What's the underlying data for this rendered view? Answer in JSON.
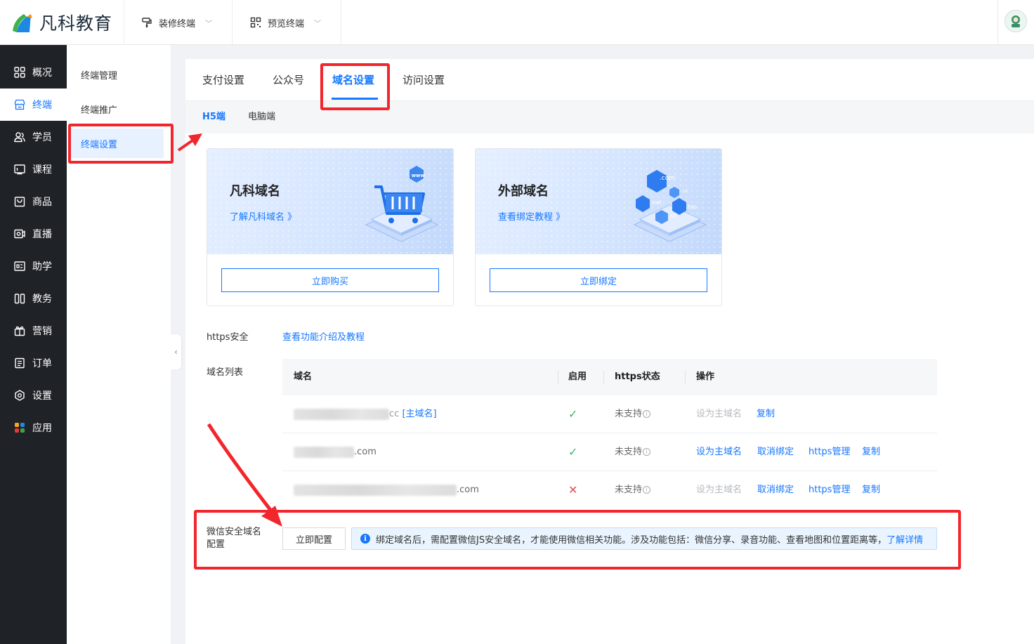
{
  "header": {
    "brand": "凡科教育",
    "menu": [
      {
        "label": "装修终端",
        "icon": "paint-roller-icon"
      },
      {
        "label": "预览终端",
        "icon": "qr-code-icon"
      }
    ]
  },
  "sidebar": {
    "items": [
      {
        "label": "概况",
        "icon": "grid-icon"
      },
      {
        "label": "终端",
        "icon": "store-icon"
      },
      {
        "label": "学员",
        "icon": "users-icon"
      },
      {
        "label": "课程",
        "icon": "course-icon"
      },
      {
        "label": "商品",
        "icon": "bag-icon"
      },
      {
        "label": "直播",
        "icon": "live-icon"
      },
      {
        "label": "助学",
        "icon": "assist-icon"
      },
      {
        "label": "教务",
        "icon": "book-icon"
      },
      {
        "label": "营销",
        "icon": "gift-icon"
      },
      {
        "label": "订单",
        "icon": "order-icon"
      },
      {
        "label": "设置",
        "icon": "settings-icon"
      },
      {
        "label": "应用",
        "icon": "apps-icon"
      }
    ],
    "active_index": 1
  },
  "subnav": {
    "items": [
      {
        "label": "终端管理"
      },
      {
        "label": "终端推广"
      },
      {
        "label": "终端设置"
      }
    ],
    "active_index": 2
  },
  "tabs": {
    "items": [
      {
        "label": "支付设置"
      },
      {
        "label": "公众号"
      },
      {
        "label": "域名设置"
      },
      {
        "label": "访问设置"
      }
    ],
    "active_index": 2
  },
  "subtabs": {
    "items": [
      {
        "label": "H5端"
      },
      {
        "label": "电脑端"
      }
    ],
    "active_index": 0
  },
  "cards": [
    {
      "title": "凡科域名",
      "link": "了解凡科域名 》",
      "button": "立即购买",
      "tags": [
        "www"
      ]
    },
    {
      "title": "外部域名",
      "link": "查看绑定教程 》",
      "button": "立即绑定",
      "tags": [
        ".com",
        ".cc",
        ".net",
        ".top",
        ".cn"
      ]
    }
  ],
  "https": {
    "label": "https安全",
    "link": "查看功能介绍及教程"
  },
  "domain_list": {
    "label": "域名列表",
    "columns": [
      "域名",
      "启用",
      "https状态",
      "操作"
    ],
    "rows": [
      {
        "domain_suffix": "cc",
        "main_tag": "[主域名]",
        "enabled": "✓",
        "https": "未支持",
        "actions": [
          "设为主域名",
          "复制"
        ]
      },
      {
        "domain_suffix": ".com",
        "main_tag": "",
        "enabled": "✓",
        "https": "未支持",
        "actions": [
          "设为主域名",
          "取消绑定",
          "https管理",
          "复制"
        ]
      },
      {
        "domain_suffix": ".com",
        "main_tag": "",
        "enabled": "✕",
        "https": "未支持",
        "actions": [
          "设为主域名",
          "取消绑定",
          "https管理",
          "复制"
        ]
      }
    ]
  },
  "wechat": {
    "label_line1": "微信安全域名",
    "label_line2": "配置",
    "button": "立即配置",
    "notice": "绑定域名后，需配置微信JS安全域名，才能使用微信相关功能。涉及功能包括：微信分享、录音功能、查看地图和位置距离等，",
    "notice_link": "了解详情"
  },
  "colors": {
    "primary": "#1677ff",
    "sidebar_bg": "#1f2227",
    "highlight": "#f2262d",
    "enabled": "#3cb371",
    "disabled": "#e34d59"
  }
}
